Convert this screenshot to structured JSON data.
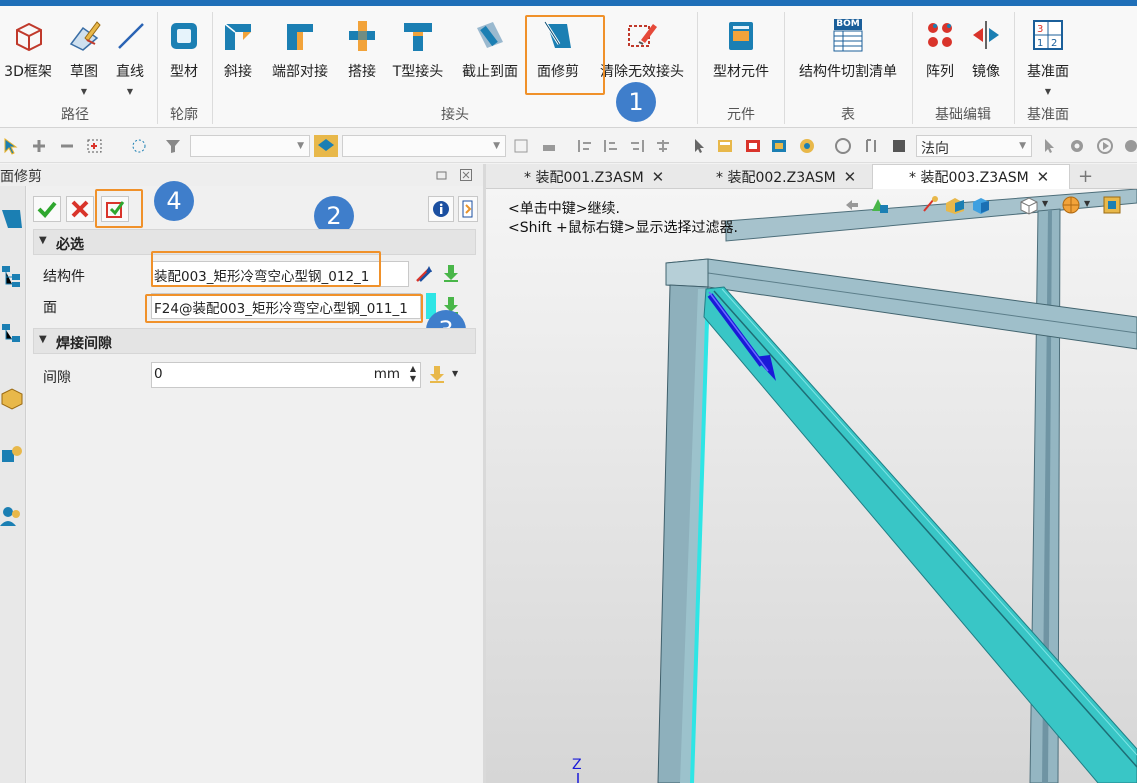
{
  "ribbon": {
    "buttons": [
      {
        "id": "3d-frame",
        "label": "3D框架",
        "icon": "cube-wireframe-icon"
      },
      {
        "id": "sketch",
        "label": "草图",
        "icon": "sketch-pencil-icon"
      },
      {
        "id": "line",
        "label": "直线",
        "icon": "line-icon"
      },
      {
        "id": "profile",
        "label": "型材",
        "icon": "profile-icon"
      },
      {
        "id": "miter",
        "label": "斜接",
        "icon": "miter-joint-icon"
      },
      {
        "id": "end-butt",
        "label": "端部对接",
        "icon": "end-butt-joint-icon"
      },
      {
        "id": "lap",
        "label": "搭接",
        "icon": "lap-joint-icon"
      },
      {
        "id": "t-joint",
        "label": "T型接头",
        "icon": "t-joint-icon"
      },
      {
        "id": "trim-to-face",
        "label": "截止到面",
        "icon": "trim-to-face-icon"
      },
      {
        "id": "face-trim",
        "label": "面修剪",
        "icon": "face-trim-icon"
      },
      {
        "id": "clear-invalid",
        "label": "清除无效接头",
        "icon": "clear-invalid-joint-icon"
      },
      {
        "id": "profile-element",
        "label": "型材元件",
        "icon": "profile-element-icon"
      },
      {
        "id": "cut-list",
        "label": "结构件切割清单",
        "icon": "bom-icon",
        "icon_text": "BOM"
      },
      {
        "id": "array",
        "label": "阵列",
        "icon": "array-icon"
      },
      {
        "id": "mirror",
        "label": "镜像",
        "icon": "mirror-icon"
      },
      {
        "id": "datum-plane",
        "label": "基准面",
        "icon": "datum-plane-icon"
      }
    ],
    "groups": [
      "路径",
      "轮廓",
      "接头",
      "元件",
      "表",
      "基础编辑",
      "基准面"
    ]
  },
  "toolbar": {
    "view_combo": "法向"
  },
  "panel": {
    "title": "面修剪",
    "sections": {
      "required": "必选",
      "weld_gap": "焊接间隙"
    },
    "fields": {
      "structure_label": "结构件",
      "structure_value": "装配003_矩形冷弯空心型钢_012_1",
      "face_label": "面",
      "face_value": "F24@装配003_矩形冷弯空心型钢_011_1",
      "gap_label": "间隙",
      "gap_value": "0",
      "gap_unit": "mm"
    }
  },
  "tabs": [
    {
      "label": "* 装配001.Z3ASM",
      "active": false
    },
    {
      "label": "* 装配002.Z3ASM",
      "active": false
    },
    {
      "label": "* 装配003.Z3ASM",
      "active": true
    }
  ],
  "viewport": {
    "hint_1": "<单击中键>继续.",
    "hint_2": "<Shift +鼠标右键>显示选择过滤器.",
    "axis_label": "Z"
  },
  "annotations": [
    "1",
    "2",
    "3",
    "4"
  ],
  "colors": {
    "highlight": "#f0912a",
    "badge": "#3f7ecb",
    "beam": "#8fb3c0",
    "selected_beam": "#39c6c6",
    "direction_arrow": "#1a1ad8"
  }
}
